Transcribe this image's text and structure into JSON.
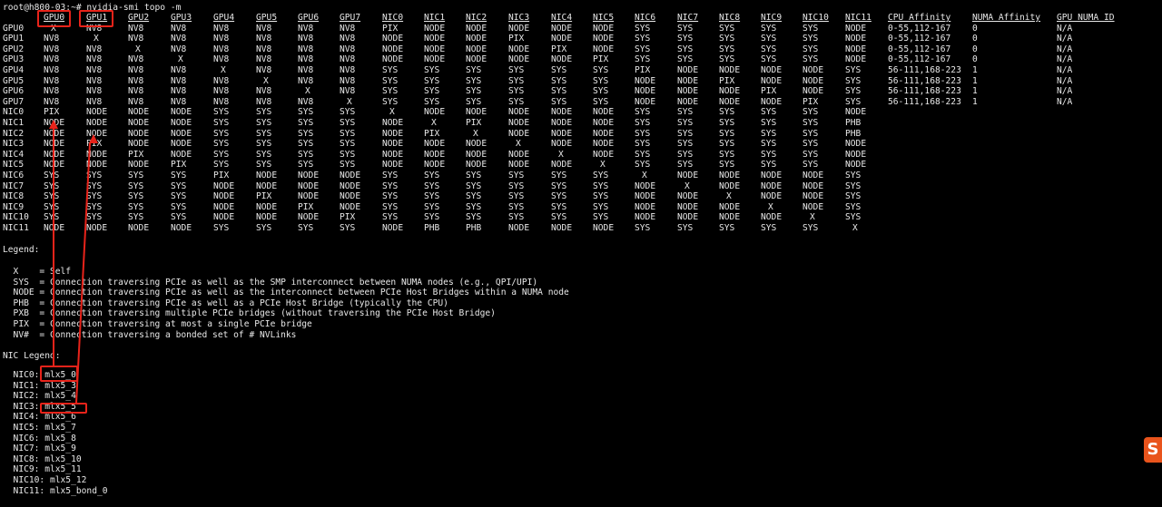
{
  "prompt": "root@h800-03:~# nvidia-smi topo -m",
  "matrix": {
    "columns": [
      "GPU0",
      "GPU1",
      "GPU2",
      "GPU3",
      "GPU4",
      "GPU5",
      "GPU6",
      "GPU7",
      "NIC0",
      "NIC1",
      "NIC2",
      "NIC3",
      "NIC4",
      "NIC5",
      "NIC6",
      "NIC7",
      "NIC8",
      "NIC9",
      "NIC10",
      "NIC11",
      "CPU Affinity",
      "NUMA Affinity",
      "GPU NUMA ID"
    ],
    "rows": [
      {
        "label": "GPU0",
        "cells": [
          "X",
          "NV8",
          "NV8",
          "NV8",
          "NV8",
          "NV8",
          "NV8",
          "NV8",
          "PIX",
          "NODE",
          "NODE",
          "NODE",
          "NODE",
          "NODE",
          "SYS",
          "SYS",
          "SYS",
          "SYS",
          "SYS",
          "NODE",
          "0-55,112-167",
          "0",
          "N/A"
        ]
      },
      {
        "label": "GPU1",
        "cells": [
          "NV8",
          "X",
          "NV8",
          "NV8",
          "NV8",
          "NV8",
          "NV8",
          "NV8",
          "NODE",
          "NODE",
          "NODE",
          "PIX",
          "NODE",
          "NODE",
          "SYS",
          "SYS",
          "SYS",
          "SYS",
          "SYS",
          "NODE",
          "0-55,112-167",
          "0",
          "N/A"
        ]
      },
      {
        "label": "GPU2",
        "cells": [
          "NV8",
          "NV8",
          "X",
          "NV8",
          "NV8",
          "NV8",
          "NV8",
          "NV8",
          "NODE",
          "NODE",
          "NODE",
          "NODE",
          "PIX",
          "NODE",
          "SYS",
          "SYS",
          "SYS",
          "SYS",
          "SYS",
          "NODE",
          "0-55,112-167",
          "0",
          "N/A"
        ]
      },
      {
        "label": "GPU3",
        "cells": [
          "NV8",
          "NV8",
          "NV8",
          "X",
          "NV8",
          "NV8",
          "NV8",
          "NV8",
          "NODE",
          "NODE",
          "NODE",
          "NODE",
          "NODE",
          "PIX",
          "SYS",
          "SYS",
          "SYS",
          "SYS",
          "SYS",
          "NODE",
          "0-55,112-167",
          "0",
          "N/A"
        ]
      },
      {
        "label": "GPU4",
        "cells": [
          "NV8",
          "NV8",
          "NV8",
          "NV8",
          "X",
          "NV8",
          "NV8",
          "NV8",
          "SYS",
          "SYS",
          "SYS",
          "SYS",
          "SYS",
          "SYS",
          "PIX",
          "NODE",
          "NODE",
          "NODE",
          "NODE",
          "SYS",
          "56-111,168-223",
          "1",
          "N/A"
        ]
      },
      {
        "label": "GPU5",
        "cells": [
          "NV8",
          "NV8",
          "NV8",
          "NV8",
          "NV8",
          "X",
          "NV8",
          "NV8",
          "SYS",
          "SYS",
          "SYS",
          "SYS",
          "SYS",
          "SYS",
          "NODE",
          "NODE",
          "PIX",
          "NODE",
          "NODE",
          "SYS",
          "56-111,168-223",
          "1",
          "N/A"
        ]
      },
      {
        "label": "GPU6",
        "cells": [
          "NV8",
          "NV8",
          "NV8",
          "NV8",
          "NV8",
          "NV8",
          "X",
          "NV8",
          "SYS",
          "SYS",
          "SYS",
          "SYS",
          "SYS",
          "SYS",
          "NODE",
          "NODE",
          "NODE",
          "PIX",
          "NODE",
          "SYS",
          "56-111,168-223",
          "1",
          "N/A"
        ]
      },
      {
        "label": "GPU7",
        "cells": [
          "NV8",
          "NV8",
          "NV8",
          "NV8",
          "NV8",
          "NV8",
          "NV8",
          "X",
          "SYS",
          "SYS",
          "SYS",
          "SYS",
          "SYS",
          "SYS",
          "NODE",
          "NODE",
          "NODE",
          "NODE",
          "PIX",
          "SYS",
          "56-111,168-223",
          "1",
          "N/A"
        ]
      },
      {
        "label": "NIC0",
        "cells": [
          "PIX",
          "NODE",
          "NODE",
          "NODE",
          "SYS",
          "SYS",
          "SYS",
          "SYS",
          "X",
          "NODE",
          "NODE",
          "NODE",
          "NODE",
          "NODE",
          "SYS",
          "SYS",
          "SYS",
          "SYS",
          "SYS",
          "NODE"
        ]
      },
      {
        "label": "NIC1",
        "cells": [
          "NODE",
          "NODE",
          "NODE",
          "NODE",
          "SYS",
          "SYS",
          "SYS",
          "SYS",
          "NODE",
          "X",
          "PIX",
          "NODE",
          "NODE",
          "NODE",
          "SYS",
          "SYS",
          "SYS",
          "SYS",
          "SYS",
          "PHB"
        ]
      },
      {
        "label": "NIC2",
        "cells": [
          "NODE",
          "NODE",
          "NODE",
          "NODE",
          "SYS",
          "SYS",
          "SYS",
          "SYS",
          "NODE",
          "PIX",
          "X",
          "NODE",
          "NODE",
          "NODE",
          "SYS",
          "SYS",
          "SYS",
          "SYS",
          "SYS",
          "PHB"
        ]
      },
      {
        "label": "NIC3",
        "cells": [
          "NODE",
          "PIX",
          "NODE",
          "NODE",
          "SYS",
          "SYS",
          "SYS",
          "SYS",
          "NODE",
          "NODE",
          "NODE",
          "X",
          "NODE",
          "NODE",
          "SYS",
          "SYS",
          "SYS",
          "SYS",
          "SYS",
          "NODE"
        ]
      },
      {
        "label": "NIC4",
        "cells": [
          "NODE",
          "NODE",
          "PIX",
          "NODE",
          "SYS",
          "SYS",
          "SYS",
          "SYS",
          "NODE",
          "NODE",
          "NODE",
          "NODE",
          "X",
          "NODE",
          "SYS",
          "SYS",
          "SYS",
          "SYS",
          "SYS",
          "NODE"
        ]
      },
      {
        "label": "NIC5",
        "cells": [
          "NODE",
          "NODE",
          "NODE",
          "PIX",
          "SYS",
          "SYS",
          "SYS",
          "SYS",
          "NODE",
          "NODE",
          "NODE",
          "NODE",
          "NODE",
          "X",
          "SYS",
          "SYS",
          "SYS",
          "SYS",
          "SYS",
          "NODE"
        ]
      },
      {
        "label": "NIC6",
        "cells": [
          "SYS",
          "SYS",
          "SYS",
          "SYS",
          "PIX",
          "NODE",
          "NODE",
          "NODE",
          "SYS",
          "SYS",
          "SYS",
          "SYS",
          "SYS",
          "SYS",
          "X",
          "NODE",
          "NODE",
          "NODE",
          "NODE",
          "SYS"
        ]
      },
      {
        "label": "NIC7",
        "cells": [
          "SYS",
          "SYS",
          "SYS",
          "SYS",
          "NODE",
          "NODE",
          "NODE",
          "NODE",
          "SYS",
          "SYS",
          "SYS",
          "SYS",
          "SYS",
          "SYS",
          "NODE",
          "X",
          "NODE",
          "NODE",
          "NODE",
          "SYS"
        ]
      },
      {
        "label": "NIC8",
        "cells": [
          "SYS",
          "SYS",
          "SYS",
          "SYS",
          "NODE",
          "PIX",
          "NODE",
          "NODE",
          "SYS",
          "SYS",
          "SYS",
          "SYS",
          "SYS",
          "SYS",
          "NODE",
          "NODE",
          "X",
          "NODE",
          "NODE",
          "SYS"
        ]
      },
      {
        "label": "NIC9",
        "cells": [
          "SYS",
          "SYS",
          "SYS",
          "SYS",
          "NODE",
          "NODE",
          "PIX",
          "NODE",
          "SYS",
          "SYS",
          "SYS",
          "SYS",
          "SYS",
          "SYS",
          "NODE",
          "NODE",
          "NODE",
          "X",
          "NODE",
          "SYS"
        ]
      },
      {
        "label": "NIC10",
        "cells": [
          "SYS",
          "SYS",
          "SYS",
          "SYS",
          "NODE",
          "NODE",
          "NODE",
          "PIX",
          "SYS",
          "SYS",
          "SYS",
          "SYS",
          "SYS",
          "SYS",
          "NODE",
          "NODE",
          "NODE",
          "NODE",
          "X",
          "SYS"
        ]
      },
      {
        "label": "NIC11",
        "cells": [
          "NODE",
          "NODE",
          "NODE",
          "NODE",
          "SYS",
          "SYS",
          "SYS",
          "SYS",
          "NODE",
          "PHB",
          "PHB",
          "NODE",
          "NODE",
          "NODE",
          "SYS",
          "SYS",
          "SYS",
          "SYS",
          "SYS",
          "X"
        ]
      }
    ]
  },
  "legend": {
    "title": "Legend:",
    "items": [
      "  X    = Self",
      "  SYS  = Connection traversing PCIe as well as the SMP interconnect between NUMA nodes (e.g., QPI/UPI)",
      "  NODE = Connection traversing PCIe as well as the interconnect between PCIe Host Bridges within a NUMA node",
      "  PHB  = Connection traversing PCIe as well as a PCIe Host Bridge (typically the CPU)",
      "  PXB  = Connection traversing multiple PCIe bridges (without traversing the PCIe Host Bridge)",
      "  PIX  = Connection traversing at most a single PCIe bridge",
      "  NV#  = Connection traversing a bonded set of # NVLinks"
    ]
  },
  "nic_legend": {
    "title": "NIC Legend:",
    "items": [
      "  NIC0: mlx5_0",
      "  NIC1: mlx5_3",
      "  NIC2: mlx5_4",
      "  NIC3: mlx5_5",
      "  NIC4: mlx5_6",
      "  NIC5: mlx5_7",
      "  NIC6: mlx5_8",
      "  NIC7: mlx5_9",
      "  NIC8: mlx5_10",
      "  NIC9: mlx5_11",
      "  NIC10: mlx5_12",
      "  NIC11: mlx5_bond_0"
    ]
  },
  "colors": {
    "background": "#000000",
    "text": "#e8e8e8",
    "annotation": "#e8231a",
    "logo": "#e9541c"
  },
  "logo_text": "S"
}
